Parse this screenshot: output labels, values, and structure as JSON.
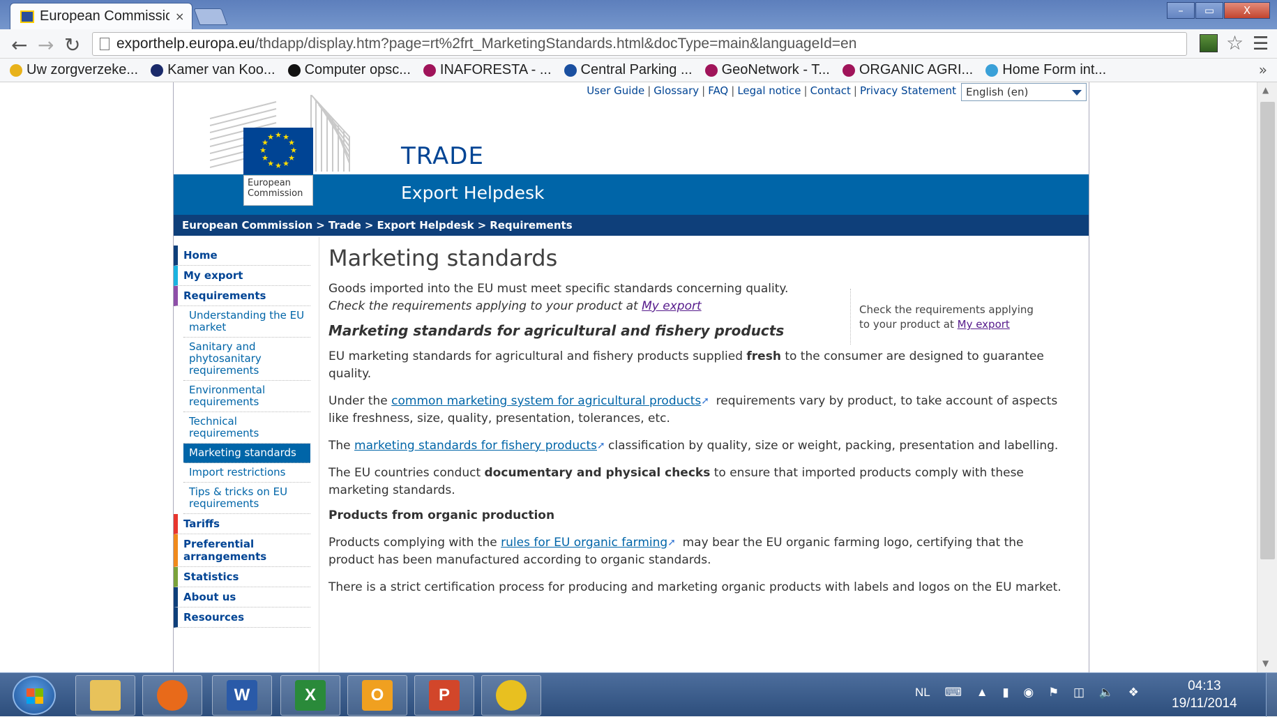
{
  "browser": {
    "tab_title": "European Commissic",
    "tab_close": "×",
    "window_buttons": {
      "minimize": "–",
      "maximize": "▭",
      "close": "X"
    },
    "url_host": "exporthelp.europa.eu",
    "url_path": "/thdapp/display.htm?page=rt%2frt_MarketingStandards.html&docType=main&languageId=en",
    "bookmarks": [
      {
        "label": "Uw zorgverzeke...",
        "color": "#e8b21a"
      },
      {
        "label": "Kamer van Koo...",
        "color": "#1a2a6a"
      },
      {
        "label": "Computer opsc...",
        "color": "#111111"
      },
      {
        "label": "INAFORESTA - ...",
        "color": "#a0145a"
      },
      {
        "label": "Central Parking ...",
        "color": "#1a4fa0"
      },
      {
        "label": "GeoNetwork - T...",
        "color": "#a0145a"
      },
      {
        "label": "ORGANIC AGRI...",
        "color": "#a0145a"
      },
      {
        "label": "Home  Form int...",
        "color": "#3aa0d8"
      }
    ],
    "bookmarks_more": "»"
  },
  "site": {
    "top_links": [
      "User Guide",
      "Glossary",
      "FAQ",
      "Legal notice",
      "Contact",
      "Privacy Statement"
    ],
    "language": "English (en)",
    "logo_text_1": "European",
    "logo_text_2": "Commission",
    "section_title": "TRADE",
    "subtitle": "Export Helpdesk",
    "breadcrumb": [
      "European Commission",
      "Trade",
      "Export Helpdesk",
      "Requirements"
    ],
    "nav": [
      {
        "label": "Home",
        "color": "#0e3f7a"
      },
      {
        "label": "My export",
        "color": "#1ab3e0"
      },
      {
        "label": "Requirements",
        "color": "#8e4fa8"
      }
    ],
    "subnav": [
      "Understanding the EU market",
      "Sanitary and phytosanitary requirements",
      "Environmental requirements",
      "Technical requirements",
      "Marketing standards",
      "Import restrictions",
      "Tips & tricks on EU requirements"
    ],
    "nav_bottom": [
      {
        "label": "Tariffs",
        "color": "#e8362e"
      },
      {
        "label": "Preferential arrangements",
        "color": "#f08a1c"
      },
      {
        "label": "Statistics",
        "color": "#7aa23a"
      },
      {
        "label": "About us",
        "color": "#0e3f7a"
      },
      {
        "label": "Resources",
        "color": "#0e3f7a"
      }
    ]
  },
  "content": {
    "title": "Marketing standards",
    "intro_1": "Goods imported into the EU must meet specific standards concerning quality.",
    "intro_2_pre": "Check the requirements applying to your product at ",
    "intro_2_link": "My export",
    "h_agri": "Marketing standards for agricultural and fishery products",
    "p1_pre": "EU marketing standards for agricultural and fishery products supplied ",
    "p1_bold": "fresh",
    "p1_post": " to the consumer are designed to guarantee quality.",
    "p2_pre": "Under the ",
    "p2_link": "common marketing system for agricultural products",
    "p2_post": " requirements vary by product, to take account of aspects like freshness, size, quality, presentation, tolerances, etc.",
    "p3_pre": "The ",
    "p3_link": "marketing standards for fishery products",
    "p3_post": "classification by quality, size or weight, packing, presentation and labelling.",
    "p4_pre": "The EU countries conduct ",
    "p4_bold": "documentary and physical checks",
    "p4_post": " to ensure that imported products comply with these marketing standards.",
    "h_organic": "Products from organic production",
    "p5_pre": "Products complying with the ",
    "p5_link": "rules for EU organic farming",
    "p5_post": " may bear the EU organic farming logo, certifying that the product has been manufactured according to organic standards.",
    "p6": "There is a strict certification process for producing and marketing organic products with labels and logos on the EU market.",
    "aside_pre": "Check the requirements applying to your product at ",
    "aside_link": "My export"
  },
  "taskbar": {
    "apps": [
      {
        "name": "explorer",
        "glyph": "",
        "color": "#e8c25a"
      },
      {
        "name": "firefox",
        "glyph": "",
        "color": "#e86a1a"
      },
      {
        "name": "word",
        "glyph": "W",
        "color": "#2a5aa8"
      },
      {
        "name": "excel",
        "glyph": "X",
        "color": "#2a8a3a"
      },
      {
        "name": "outlook",
        "glyph": "O",
        "color": "#f0a020"
      },
      {
        "name": "powerpoint",
        "glyph": "P",
        "color": "#d2462a"
      },
      {
        "name": "chrome",
        "glyph": "",
        "color": "#e8c020"
      }
    ],
    "language": "NL",
    "time": "04:13",
    "date": "19/11/2014"
  }
}
